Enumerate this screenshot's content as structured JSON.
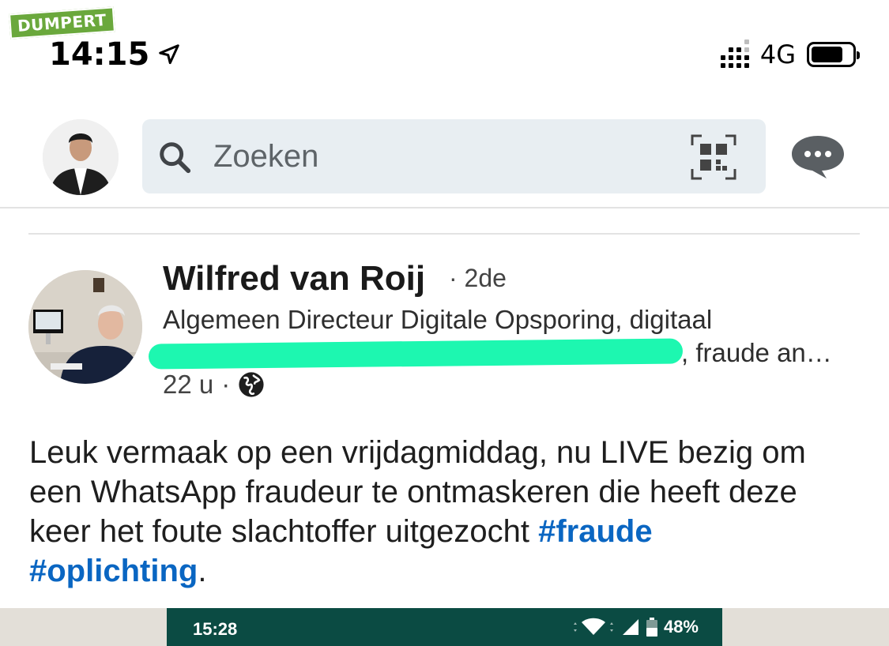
{
  "watermark": {
    "text": "DUMPERT"
  },
  "status_bar": {
    "time": "14:15",
    "network": "4G"
  },
  "header": {
    "search_placeholder": "Zoeken"
  },
  "post": {
    "author_name": "Wilfred van Roij",
    "degree": "· 2de",
    "headline_line1": "Algemeen Directeur Digitale Opsporing, digitaal",
    "headline_line2_visible": ", fraude an…",
    "time_ago": "22 u",
    "meta_separator": "·",
    "body_text": "Leuk vermaak op een vrijdagmiddag, nu LIVE bezig om een WhatsApp fraudeur te ontmaskeren die heeft deze keer het foute slachtoffer uitgezocht ",
    "hashtag_1": "#fraude",
    "hashtag_2": "#oplichting",
    "body_end": "."
  },
  "android_bar": {
    "time": "15:28",
    "battery": "48%"
  },
  "colors": {
    "accent": "#0a66c2",
    "android_bar": "#0b4b43",
    "redaction": "#1df7b0",
    "watermark": "#6aa83c"
  }
}
